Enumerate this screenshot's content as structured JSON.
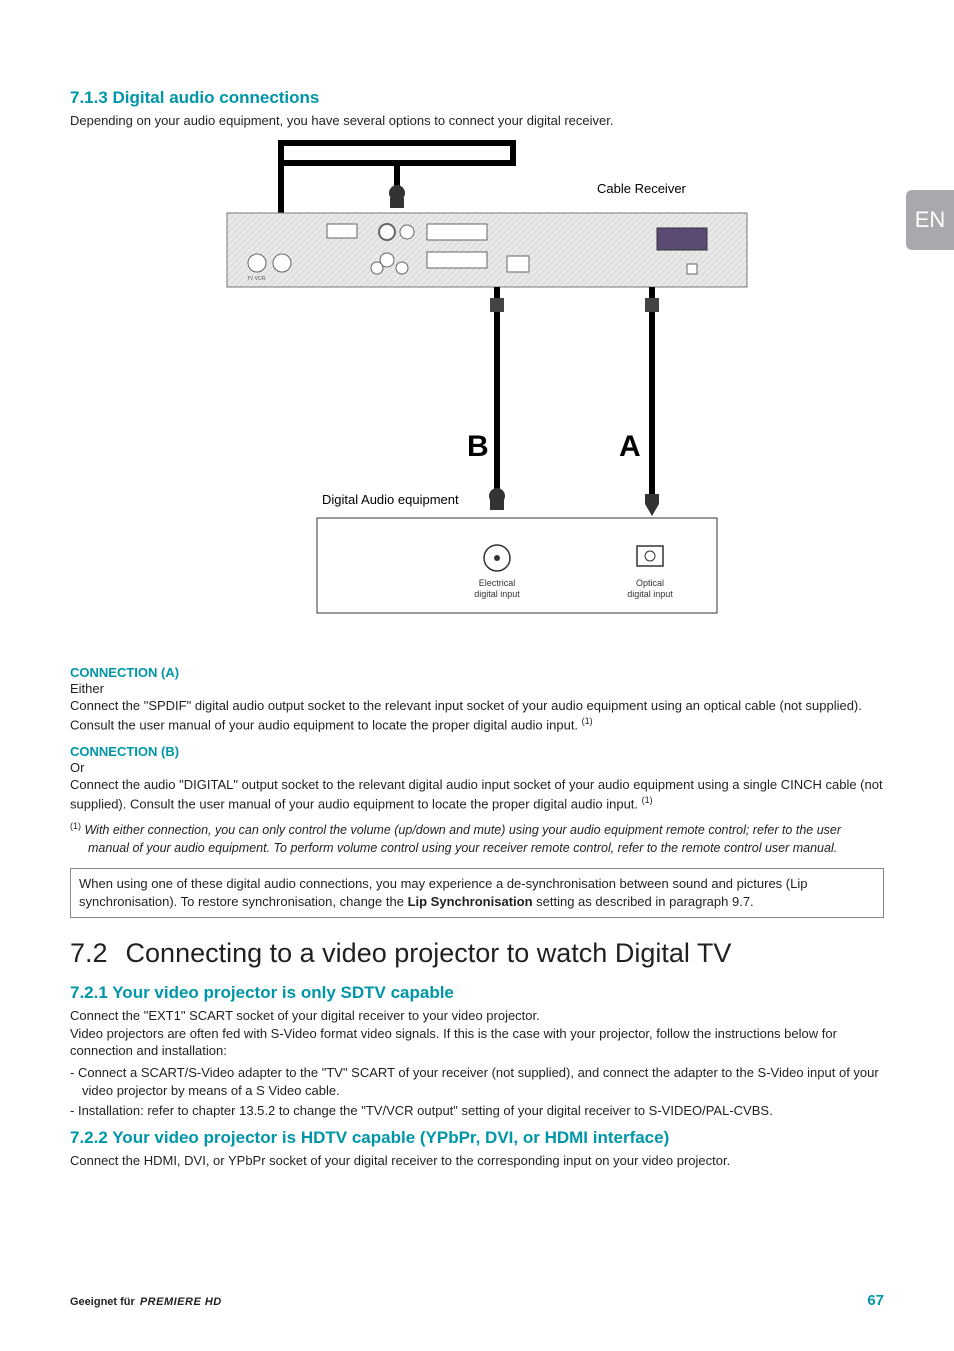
{
  "lang_tab": "EN",
  "s713": {
    "heading": "7.1.3   Digital audio connections",
    "intro": "Depending on your audio equipment, you have several options to connect your digital receiver.",
    "diagram": {
      "label_receiver": "Cable Receiver",
      "label_b": "B",
      "label_a": "A",
      "label_audio_equipment": "Digital Audio equipment",
      "label_elec_1": "Electrical",
      "label_elec_2": "digital input",
      "label_opt_1": "Optical",
      "label_opt_2": "digital input"
    },
    "conn_a_heading": "CONNECTION (A)",
    "conn_a_line1": "Either",
    "conn_a_line2_pre": "Connect the \"SPDIF\" digital audio output socket to the relevant input socket of your audio equipment using an optical cable (not supplied). Consult the user manual of your audio equipment to locate the proper digital audio input. ",
    "conn_a_sup": "(1)",
    "conn_b_heading": "CONNECTION (B)",
    "conn_b_line1": "Or",
    "conn_b_line2_pre": "Connect the audio \"DIGITAL\" output socket to the relevant digital audio input socket of your audio equipment using a single CINCH cable (not supplied). Consult the user manual of your audio equipment to locate the proper digital audio input. ",
    "conn_b_sup": "(1)",
    "footnote_sup": "(1)",
    "footnote_text": " With either connection, you can only control the volume (up/down and mute) using your audio equipment remote control; refer to the user manual of your audio equipment. To perform volume control using your receiver remote control, refer to the remote control user manual.",
    "note_pre": "When using one of these digital audio connections, you may experience a de-synchronisation between sound and pictures (Lip synchronisation). To restore synchronisation, change the ",
    "note_bold": "Lip Synchronisation",
    "note_post": " setting as described in paragraph 9.7."
  },
  "s72": {
    "num": "7.2",
    "title": "Connecting to a video projector to watch Digital TV"
  },
  "s721": {
    "heading": "7.2.1   Your video projector is only SDTV capable",
    "p1": "Connect the \"EXT1\" SCART socket of your digital receiver to your video projector.",
    "p2": "Video projectors are often fed with S-Video format video signals. If this is the case with your projector, follow the instructions below for connection and installation:",
    "bullets": [
      "Connect a SCART/S-Video adapter to the \"TV\" SCART of your receiver (not supplied), and connect the adapter to the S-Video input of your video projector by means of a S Video cable.",
      "Installation: refer to chapter 13.5.2 to change the \"TV/VCR output\" setting of your digital receiver to S-VIDEO/PAL-CVBS."
    ]
  },
  "s722": {
    "heading": "7.2.2   Your video projector is HDTV capable (YPbPr, DVI, or HDMI interface)",
    "p1": "Connect the HDMI, DVI, or YPbPr socket of your digital receiver to the corresponding input on your video projector."
  },
  "footer": {
    "left_pre": "Geeignet für ",
    "brand": "PREMIERE HD",
    "page": "67"
  }
}
